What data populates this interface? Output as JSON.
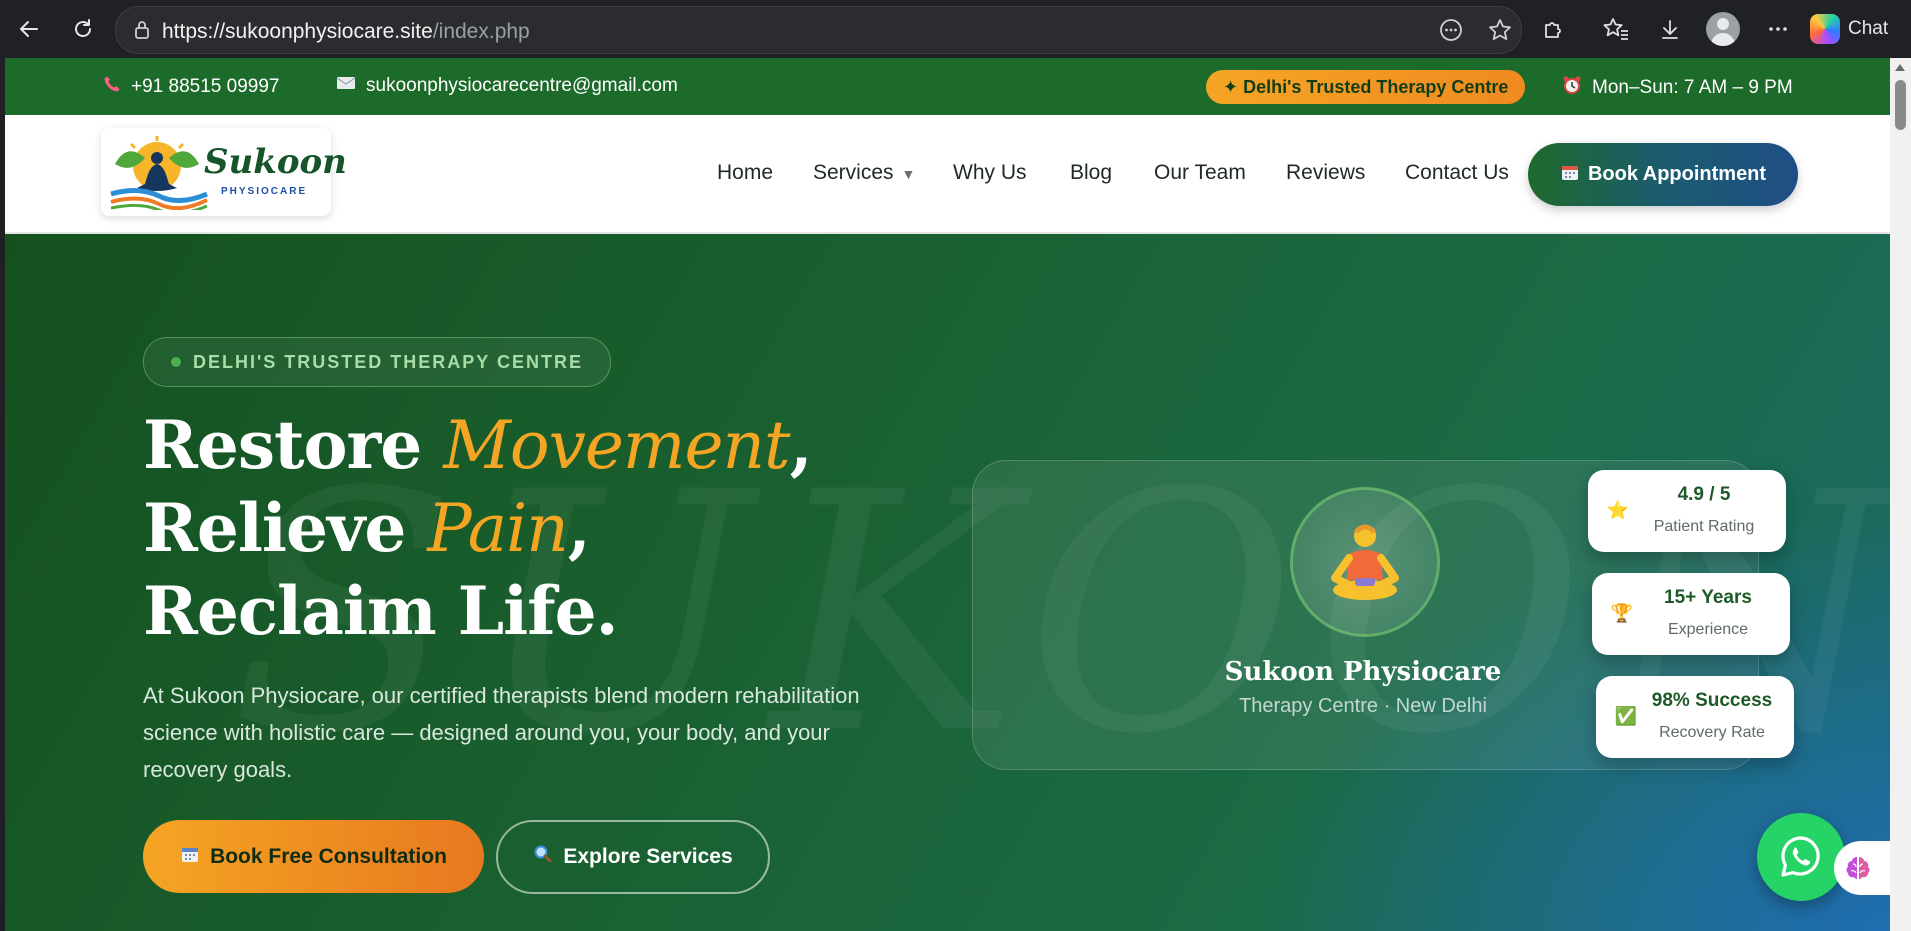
{
  "browser": {
    "url_domain": "https://sukoonphysiocare.site",
    "url_path": "/index.php",
    "chat_label": "Chat",
    "icons": [
      "back-arrow-icon",
      "reload-icon",
      "site-info-lock-icon",
      "read-aloud-icon",
      "favorite-star-icon",
      "extensions-icon",
      "favorites-list-icon",
      "downloads-icon",
      "profile-avatar-icon",
      "more-menu-icon",
      "copilot-icon"
    ]
  },
  "topbar": {
    "phone": "+91 88515 09997",
    "email": "sukoonphysiocarecentre@gmail.com",
    "badge": "✦ Delhi's Trusted Therapy Centre",
    "hours": "Mon–Sun: 7 AM – 9 PM"
  },
  "logo": {
    "word": "Sukoon",
    "sub": "PHYSIOCARE"
  },
  "nav": {
    "items": [
      "Home",
      "Services",
      "Why Us",
      "Blog",
      "Our Team",
      "Reviews",
      "Contact Us"
    ],
    "services_caret": "▼",
    "book_label": "Book Appointment"
  },
  "hero": {
    "watermark": "SUKOON",
    "eyebrow": "DELHI'S TRUSTED THERAPY CENTRE",
    "headline": {
      "line1_a": "Restore ",
      "line1_accent": "Movement",
      "line1_b": ",",
      "line2_a": "Relieve ",
      "line2_accent": "Pain",
      "line2_b": ",",
      "line3": "Reclaim Life."
    },
    "description": "At Sukoon Physiocare, our certified therapists blend modern rehabilitation science with holistic care — designed around you, your body, and your recovery goals.",
    "cta_primary": "Book Free Consultation",
    "cta_secondary": "Explore Services"
  },
  "card": {
    "emoji": "🧘",
    "title": "Sukoon Physiocare",
    "subtitle": "Therapy Centre · New Delhi"
  },
  "stats": [
    {
      "value": "4.9 / 5",
      "label": "Patient Rating",
      "icon": "⭐"
    },
    {
      "value": "15+ Years",
      "label": "Experience",
      "icon": "🏆"
    },
    {
      "value": "98% Success",
      "label": "Recovery Rate",
      "icon": "✅"
    }
  ],
  "colors": {
    "brand_green": "#1d6b2b",
    "accent_orange": "#f5a524",
    "whatsapp": "#25d366"
  }
}
